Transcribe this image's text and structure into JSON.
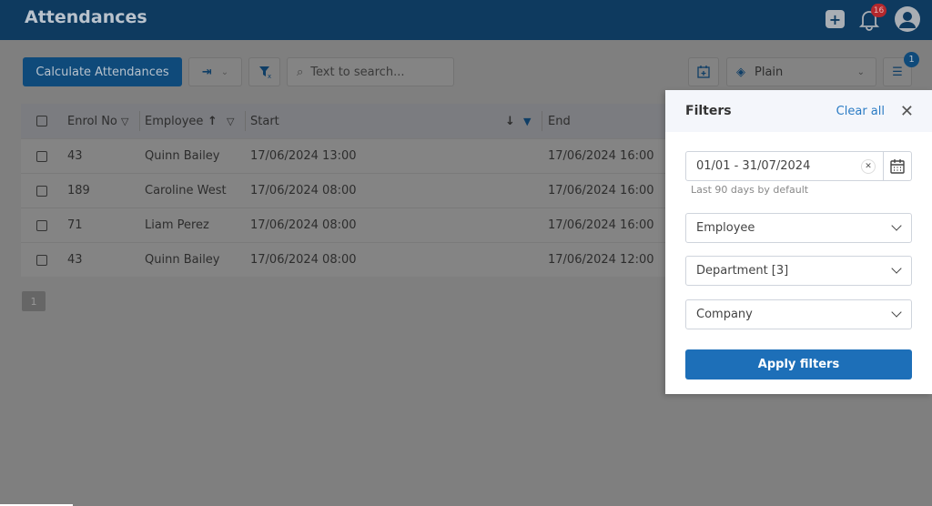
{
  "header": {
    "title": "Attendances",
    "notifications_count": "16"
  },
  "toolbar": {
    "calculate_label": "Calculate Attendances",
    "search_placeholder": "Text to search...",
    "view_select": "Plain",
    "filters_badge": "1"
  },
  "table": {
    "columns": [
      "Enrol No",
      "Employee",
      "Start",
      "End"
    ],
    "rows": [
      {
        "enrol": "43",
        "employee": "Quinn Bailey",
        "start": "17/06/2024 13:00",
        "end": "17/06/2024 16:00"
      },
      {
        "enrol": "189",
        "employee": "Caroline West",
        "start": "17/06/2024 08:00",
        "end": "17/06/2024 16:00"
      },
      {
        "enrol": "71",
        "employee": "Liam Perez",
        "start": "17/06/2024 08:00",
        "end": "17/06/2024 16:00"
      },
      {
        "enrol": "43",
        "employee": "Quinn Bailey",
        "start": "17/06/2024 08:00",
        "end": "17/06/2024 12:00"
      }
    ]
  },
  "pagination": {
    "current": "1"
  },
  "filters": {
    "title": "Filters",
    "clear_all": "Clear all",
    "date_range": "01/01 - 31/07/2024",
    "date_hint": "Last 90 days by default",
    "employee": "Employee",
    "department": "Department [3]",
    "company": "Company",
    "apply": "Apply filters"
  },
  "colors": {
    "header": "#0e3a5f",
    "accent": "#1d6fb8"
  }
}
